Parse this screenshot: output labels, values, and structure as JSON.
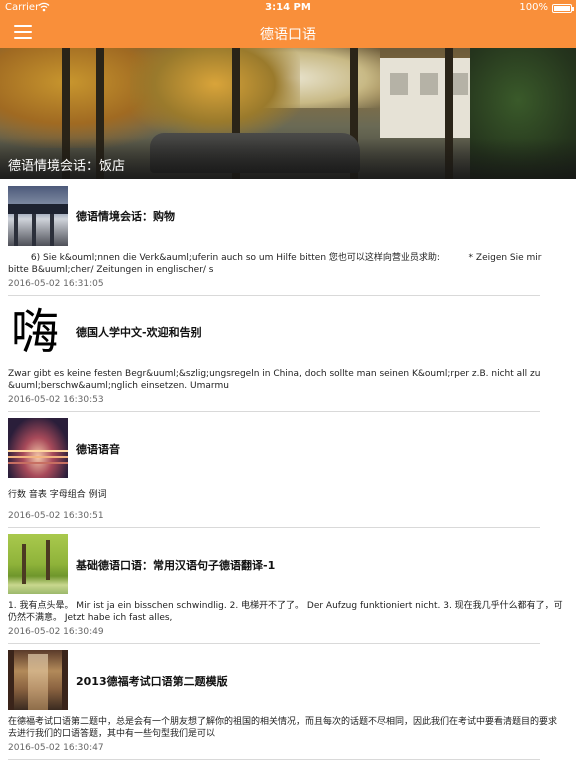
{
  "status_bar": {
    "carrier": "Carrier",
    "time": "3:14 PM",
    "battery": "100%"
  },
  "nav": {
    "title": "德语口语"
  },
  "banner": {
    "title": "德语情境会话：饭店"
  },
  "articles": [
    {
      "title": "德语情境会话：购物",
      "summary": "        6) Sie k&ouml;nnen die Verk&auml;uferin auch so um Hilfe bitten 您也可以这样向营业员求助:          * Zeigen Sie mir bitte B&uuml;cher/ Zeitungen in englischer/ s",
      "date": "2016-05-02 16:31:05",
      "thumb": "bridge-photo"
    },
    {
      "title": "德国人学中文-欢迎和告别",
      "summary": "Zwar gibt es keine festen Begr&uuml;&szlig;ungsregeln in China, doch sollte man seinen K&ouml;rper z.B. nicht all zu &uuml;berschw&auml;nglich einsetzen. Umarmu",
      "date": "2016-05-02 16:30:53",
      "thumb": "hi-glyph",
      "thumb_glyph": "嗨"
    },
    {
      "title": "德语语音",
      "summary": "行数 音表 字母组合 例词",
      "date": "2016-05-02 16:30:51",
      "thumb": "city-photo"
    },
    {
      "title": "基础德语口语：常用汉语句子德语翻译-1",
      "summary": "1.  我有点头晕。 Mir ist ja ein bisschen schwindlig. 2.  电梯开不了了。 Der Aufzug funktioniert nicht. 3.  现在我几乎什么都有了，可仍然不满意。 Jetzt habe ich fast alles,",
      "date": "2016-05-02 16:30:49",
      "thumb": "park-photo"
    },
    {
      "title": "2013德福考试口语第二题模版",
      "summary": "在德福考试口语第二题中，总是会有一个朋友想了解你的祖国的相关情况，而且每次的话题不尽相同，因此我们在考试中要看清题目的要求去进行我们的口语答题，其中有一些句型我们是可以",
      "date": "2016-05-02 16:30:47",
      "thumb": "hall-photo"
    }
  ]
}
